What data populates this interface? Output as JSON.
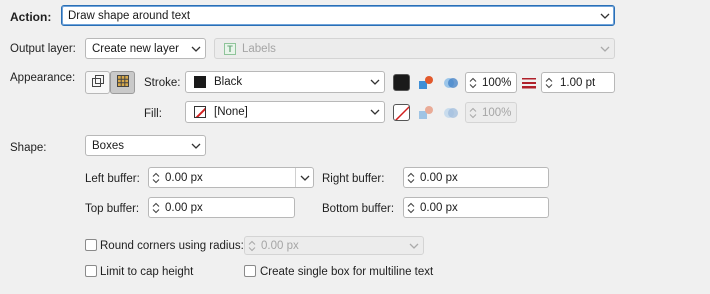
{
  "action": {
    "label": "Action:",
    "value": "Draw shape around text"
  },
  "output_layer": {
    "label": "Output layer:",
    "value": "Create new layer",
    "layer_value": "Labels"
  },
  "appearance": {
    "label": "Appearance:",
    "stroke": {
      "label": "Stroke:",
      "color_name": "Black",
      "color": "#1a1a1a",
      "opacity": "100%",
      "width": "1.00 pt"
    },
    "fill": {
      "label": "Fill:",
      "color_name": "[None]",
      "opacity": "100%"
    }
  },
  "shape": {
    "label": "Shape:",
    "value": "Boxes",
    "left_buffer": {
      "label": "Left buffer:",
      "value": "0.00 px"
    },
    "right_buffer": {
      "label": "Right buffer:",
      "value": "0.00 px"
    },
    "top_buffer": {
      "label": "Top buffer:",
      "value": "0.00 px"
    },
    "bottom_buffer": {
      "label": "Bottom buffer:",
      "value": "0.00 px"
    }
  },
  "options": {
    "round_corners": {
      "label": "Round corners using radius:",
      "value": "0.00 px",
      "checked": false
    },
    "limit_cap": {
      "label": "Limit to cap height",
      "checked": false
    },
    "single_box": {
      "label": "Create single box for multiline text",
      "checked": false
    }
  },
  "colors": {
    "accent": "#2a6fb5",
    "stroke_width_icon": "#b0202a",
    "fill_none_slash": "#d21f1f"
  }
}
